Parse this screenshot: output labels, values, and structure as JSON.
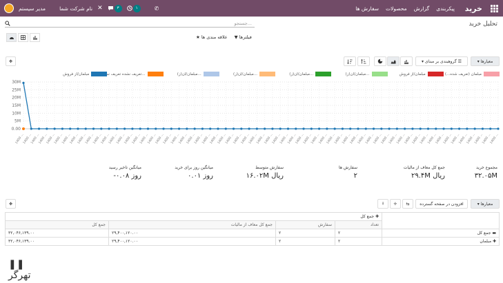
{
  "topbar": {
    "brand": "خرید",
    "menu": [
      "سفارش ها",
      "محصولات",
      "گزارش",
      "پیکربندی"
    ],
    "company": "نام شرکت شما",
    "user": "مدیر سیستم",
    "activity_count": "۱",
    "messages_count": "۳"
  },
  "breadcrumb": "تحلیل خرید",
  "search": {
    "placeholder": "جستجو..."
  },
  "filters": {
    "filters_label": "فیلترها",
    "favorites_label": "علاقه مندی ها"
  },
  "toolbar": {
    "measures_label": "معیارها",
    "groupby_label": "گروهبندی بر مبنای"
  },
  "chart_data": {
    "type": "line",
    "ylabels": [
      "30M",
      "25M",
      "20M",
      "15M",
      "10M",
      "5M",
      "0.00"
    ],
    "ylim": [
      0,
      30000000
    ],
    "grid": true,
    "legend_position": "top",
    "series": [
      {
        "name": "مبلمان (تعریف شده...)",
        "color": "#f7a0a8"
      },
      {
        "name": "مبلمان/از فروش",
        "color": "#d62728"
      },
      {
        "name": "مبلمان/ان(ز)...",
        "color": "#98df8a"
      },
      {
        "name": "مبلمان/ان(ز)...",
        "color": "#2ca02c"
      },
      {
        "name": "مبلمان/ان(ز)...",
        "color": "#ffbb78"
      },
      {
        "name": "مبلمان/ان(ز)...",
        "color": "#aec7e8"
      },
      {
        "name": "تعریف نشده تعریف نش...",
        "color": "#ff7f0e"
      },
      {
        "name": "مبلمان/از فروش",
        "color": "#1f77b4"
      }
    ],
    "points": 62,
    "spike": {
      "index": 0,
      "value": 29400120
    }
  },
  "kpis": [
    {
      "label": "مجموع خرید",
      "value": "۳۲.۰۵M"
    },
    {
      "label": "جمع کل معاف از مالیات",
      "value": "۲۹.۴M ریال"
    },
    {
      "label": "سفارش ها",
      "value": "۲"
    },
    {
      "label": "سفارش متوسط",
      "value": "۱۶.۰۲M ریال"
    },
    {
      "label": "میانگین روز برای خرید",
      "value": "۰.۰۱ روز"
    },
    {
      "label": "میانگین تاخیر رسید",
      "value": "-۰.۰۸ روز"
    }
  ],
  "pivot": {
    "measures_label": "معیارها",
    "expand_label": "افزودن در صفحه گسترده",
    "col_header": "جمع کل",
    "headers": [
      "تعداد",
      "سفارش",
      "جمع کل معاف از مالیات",
      "جمع کل"
    ],
    "rows": [
      {
        "label": "جمع کل",
        "count": "۲",
        "orders": "۲",
        "untaxed": "۲۹,۴۰۰,۱۲۰.۰۰",
        "total": "۳۲,۰۴۶,۱۳۹.۰۰"
      },
      {
        "label": "مبلمان",
        "count": "۲",
        "orders": "۲",
        "untaxed": "۲۹,۴۰۰,۱۲۰.۰۰",
        "total": "۳۲,۰۴۶,۱۳۹.۰۰"
      }
    ]
  },
  "watermark": "تهرگر"
}
